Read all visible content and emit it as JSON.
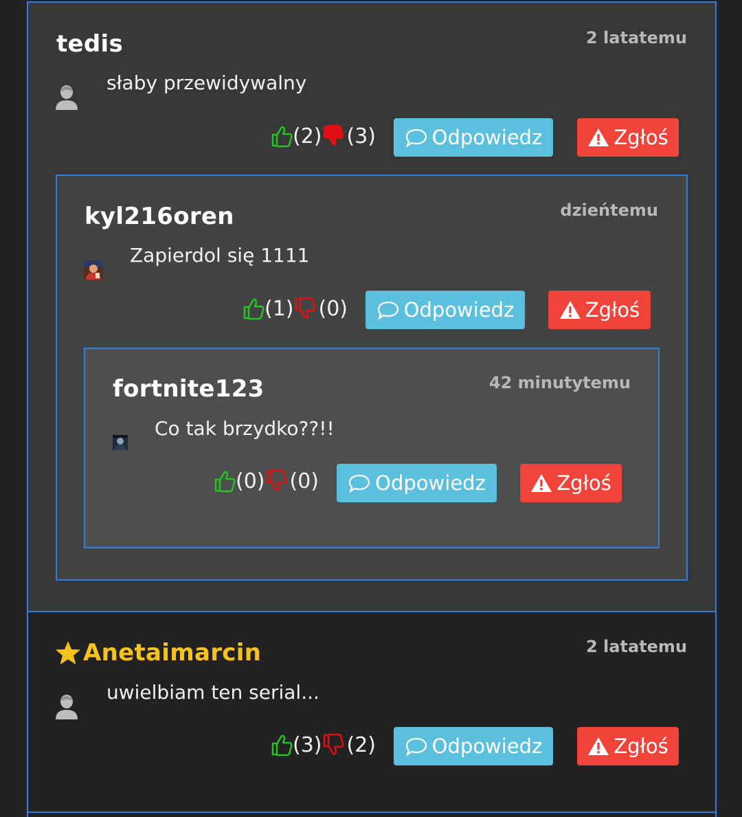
{
  "comments": [
    {
      "author": "tedis",
      "time": "2 latatemu",
      "text": "słaby przewidywalny",
      "likes": "(2)",
      "dislikes": "(3)",
      "reply_label": "Odpowiedz",
      "report_label": "Zgłoś",
      "replies": [
        {
          "author": "kyl216oren",
          "time": "dzieńtemu",
          "text": "Zapierdol się 1111",
          "likes": "(1)",
          "dislikes": "(0)",
          "reply_label": "Odpowiedz",
          "report_label": "Zgłoś",
          "replies": [
            {
              "author": "fortnite123",
              "time": "42 minutytemu",
              "text": "Co tak brzydko??!!",
              "likes": "(0)",
              "dislikes": "(0)",
              "reply_label": "Odpowiedz",
              "report_label": "Zgłoś"
            }
          ]
        }
      ]
    },
    {
      "author": "Anetaimarcin",
      "author_badge": "star-icon",
      "time": "2 latatemu",
      "text": "uwielbiam ten serial...",
      "likes": "(3)",
      "dislikes": "(2)",
      "reply_label": "Odpowiedz",
      "report_label": "Zgłoś"
    }
  ],
  "colors": {
    "page_bg": "#222222",
    "border": "#2f7de1",
    "reply_button": "#5bc0de",
    "report_button": "#f0443a",
    "like_icon": "#22c522",
    "dislike_icon": "#e01010",
    "vip_name": "#f7c21e"
  }
}
